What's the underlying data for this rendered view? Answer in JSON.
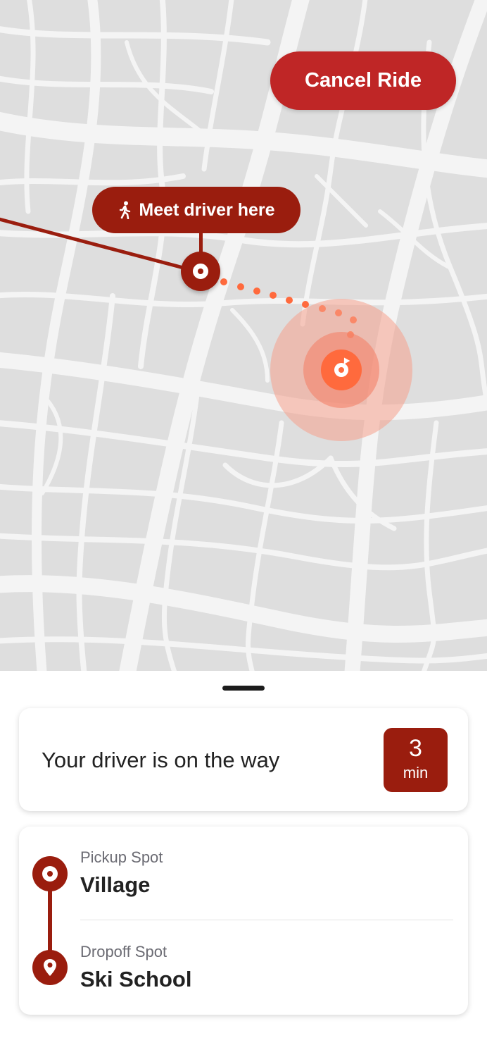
{
  "map": {
    "cancel_button_label": "Cancel Ride",
    "meet_tag_label": "Meet driver here",
    "colors": {
      "background": "#dedede",
      "streets": "#f4f4f4",
      "route": "#9a1d0e",
      "driver": "#ff6a3d",
      "cancel": "#bf2626"
    }
  },
  "status": {
    "text": "Your driver is on the way",
    "eta_value": "3",
    "eta_unit": "min"
  },
  "route": {
    "pickup_label": "Pickup Spot",
    "pickup_name": "Village",
    "dropoff_label": "Dropoff Spot",
    "dropoff_name": "Ski School"
  },
  "icons": [
    "walking-person-icon",
    "pickup-pin-icon",
    "driver-location-icon",
    "dropoff-pin-icon"
  ]
}
